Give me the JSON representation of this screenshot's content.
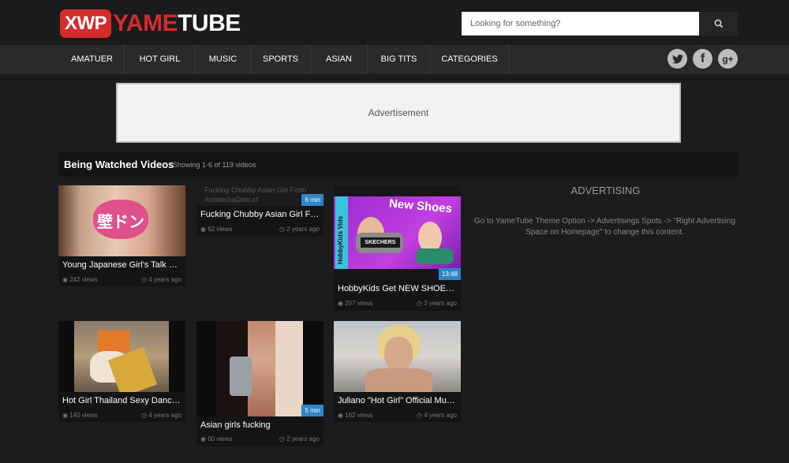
{
  "header": {
    "logo": {
      "box": "XWP",
      "yame": "YAME",
      "tube": "TUBE"
    },
    "search": {
      "placeholder": "Looking for something?"
    }
  },
  "nav": {
    "items": [
      "AMATUER",
      "HOT GIRL",
      "MUSIC",
      "SPORTS",
      "ASIAN",
      "BIG TITS",
      "CATEGORIES"
    ],
    "social": [
      "twitter-icon",
      "facebook-icon",
      "google-plus-icon"
    ]
  },
  "ad_banner": {
    "text": "Advertisement"
  },
  "section": {
    "title": "Being Watched Videos",
    "count": "Showing 1-6 of 119 videos"
  },
  "videos": [
    {
      "title": "Young Japanese Girl's Talk 壁ド...",
      "views": "242 views",
      "ago": "4 years ago",
      "duration": "",
      "thumb_text": "壁ドン"
    },
    {
      "title": "Fucking Chubby Asian Girl Fro...",
      "views": "62 views",
      "ago": "2 years ago",
      "duration": "6 min",
      "alt": "Fucking Chubby Asian Girl From AnistashaDate.cf"
    },
    {
      "title": "HobbyKids Get NEW SHOES Sk...",
      "views": "207 views",
      "ago": "3 years ago",
      "duration": "13:48",
      "thumb_text": "New Shoes",
      "thumb_side": "HobbyKids Vids",
      "thumb_brand": "SKECHERS"
    },
    {
      "title": "Hot Girl Thailand Sexy Dance ...",
      "views": "140 views",
      "ago": "4 years ago",
      "duration": ""
    },
    {
      "title": "Asian girls fucking",
      "views": "60 views",
      "ago": "2 years ago",
      "duration": "5 min"
    },
    {
      "title": "Juliano \"Hot Girl\" Official Music ...",
      "views": "162 views",
      "ago": "4 years ago",
      "duration": ""
    }
  ],
  "sidebar": {
    "title": "ADVERTISING",
    "text": "Go to YameTube Theme Option -> Advertisings Spots -> \"Right Advertising Space on Homepage\" to change this content."
  },
  "colors": {
    "accent": "#d62b2b",
    "duration_badge": "#2e86c8",
    "background": "#1c1c1e"
  }
}
